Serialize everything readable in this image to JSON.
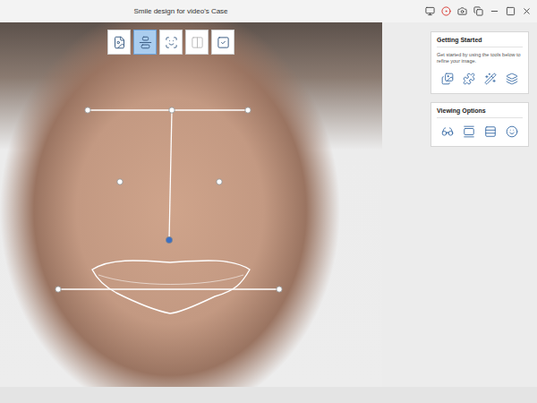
{
  "window": {
    "title": "Smile design for video's Case"
  },
  "toolbar": [
    {
      "kind": "photo",
      "selected": false,
      "disabled": false
    },
    {
      "kind": "midline",
      "selected": true,
      "disabled": false
    },
    {
      "kind": "face",
      "selected": false,
      "disabled": false
    },
    {
      "kind": "compare",
      "selected": false,
      "disabled": true
    },
    {
      "kind": "finish",
      "selected": false,
      "disabled": false
    }
  ],
  "panels": [
    {
      "title": "Getting Started",
      "description": "Get started by using the tools below to refine your image.",
      "tools": [
        {
          "kind": "images"
        },
        {
          "kind": "puzzle"
        },
        {
          "kind": "wand"
        },
        {
          "kind": "layers"
        }
      ]
    },
    {
      "title": "Viewing Options",
      "description": "",
      "tools": [
        {
          "kind": "glasses"
        },
        {
          "kind": "gallery"
        },
        {
          "kind": "rows"
        },
        {
          "kind": "smile"
        }
      ]
    }
  ]
}
